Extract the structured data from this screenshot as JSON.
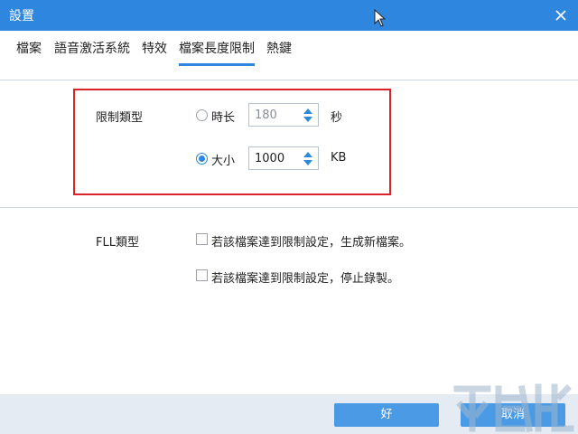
{
  "window": {
    "title": "設置"
  },
  "tabs": [
    {
      "label": "檔案"
    },
    {
      "label": "語音激活系統"
    },
    {
      "label": "特效"
    },
    {
      "label": "檔案長度限制",
      "active": true
    },
    {
      "label": "熱鍵"
    }
  ],
  "limit": {
    "label": "限制類型",
    "time": {
      "label": "時长",
      "value": "180",
      "unit": "秒",
      "selected": false
    },
    "size": {
      "label": "大小",
      "value": "1000",
      "unit": "KB",
      "selected": true
    }
  },
  "fll": {
    "label": "FLL類型",
    "options": [
      {
        "label": "若該檔案達到限制設定，生成新檔案。",
        "checked": false
      },
      {
        "label": "若該檔案達到限制設定，停止錄製。",
        "checked": false
      }
    ]
  },
  "buttons": {
    "ok": "好",
    "cancel": "取消"
  },
  "colors": {
    "accent": "#2e86de",
    "highlight_border": "#d9252a"
  },
  "icons": {
    "close": "close-icon",
    "cursor": "mouse-cursor-icon",
    "spin": "spin-arrows-icon",
    "watermark": "watermark-logo"
  }
}
